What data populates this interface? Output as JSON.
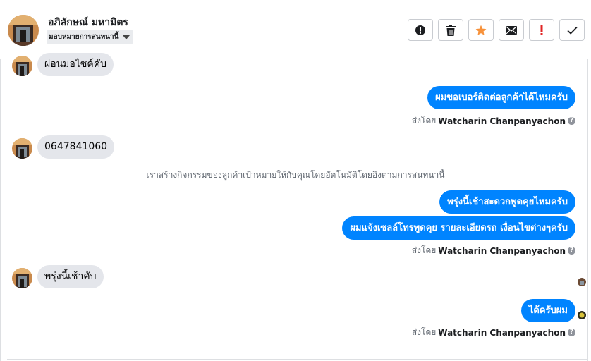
{
  "header": {
    "contact_name": "อภิลักษณ์ มหามิตร",
    "assign_label": "มอบหมายการสนทนานี้",
    "actions": [
      {
        "name": "spam-report-button",
        "icon": "exclamation-circle-icon"
      },
      {
        "name": "delete-button",
        "icon": "trash-icon"
      },
      {
        "name": "star-button",
        "icon": "star-icon"
      },
      {
        "name": "mark-unread-button",
        "icon": "envelope-icon"
      },
      {
        "name": "follow-up-button",
        "icon": "exclamation-icon"
      },
      {
        "name": "mark-done-button",
        "icon": "checkmark-icon"
      }
    ]
  },
  "messages": {
    "in_1": "ผ่อนมอไซค์คับ",
    "out_1": "ผมขอเบอร์ติดต่อลูกค้าได้ไหมครับ",
    "in_2": "0647841060",
    "system_note": "เราสร้างกิจกรรมของลูกค้าเป้าหมายให้กับคุณโดยอัตโนมัติโดยอิงตามการสนทนานี้",
    "out_2": "พรุ่งนี้เช้าสะดวกพูดคุยไหมครับ",
    "out_3": "ผมแจ้งเซลล์โทรพูดคุย รายละเอียดรถ เงื่อนไขต่างๆครับ",
    "in_3": "พรุ่งนี้เช้าคับ",
    "out_4": "ได้ครับผม"
  },
  "sent_by": {
    "prefix": "ส่งโดย",
    "agent": "Watcharin Chanpanyachon",
    "help": "?"
  },
  "colors": {
    "outgoing_bubble": "#0084ff",
    "incoming_bubble": "#e4e6eb",
    "star": "#f7923b",
    "follow_up": "#e02424"
  }
}
